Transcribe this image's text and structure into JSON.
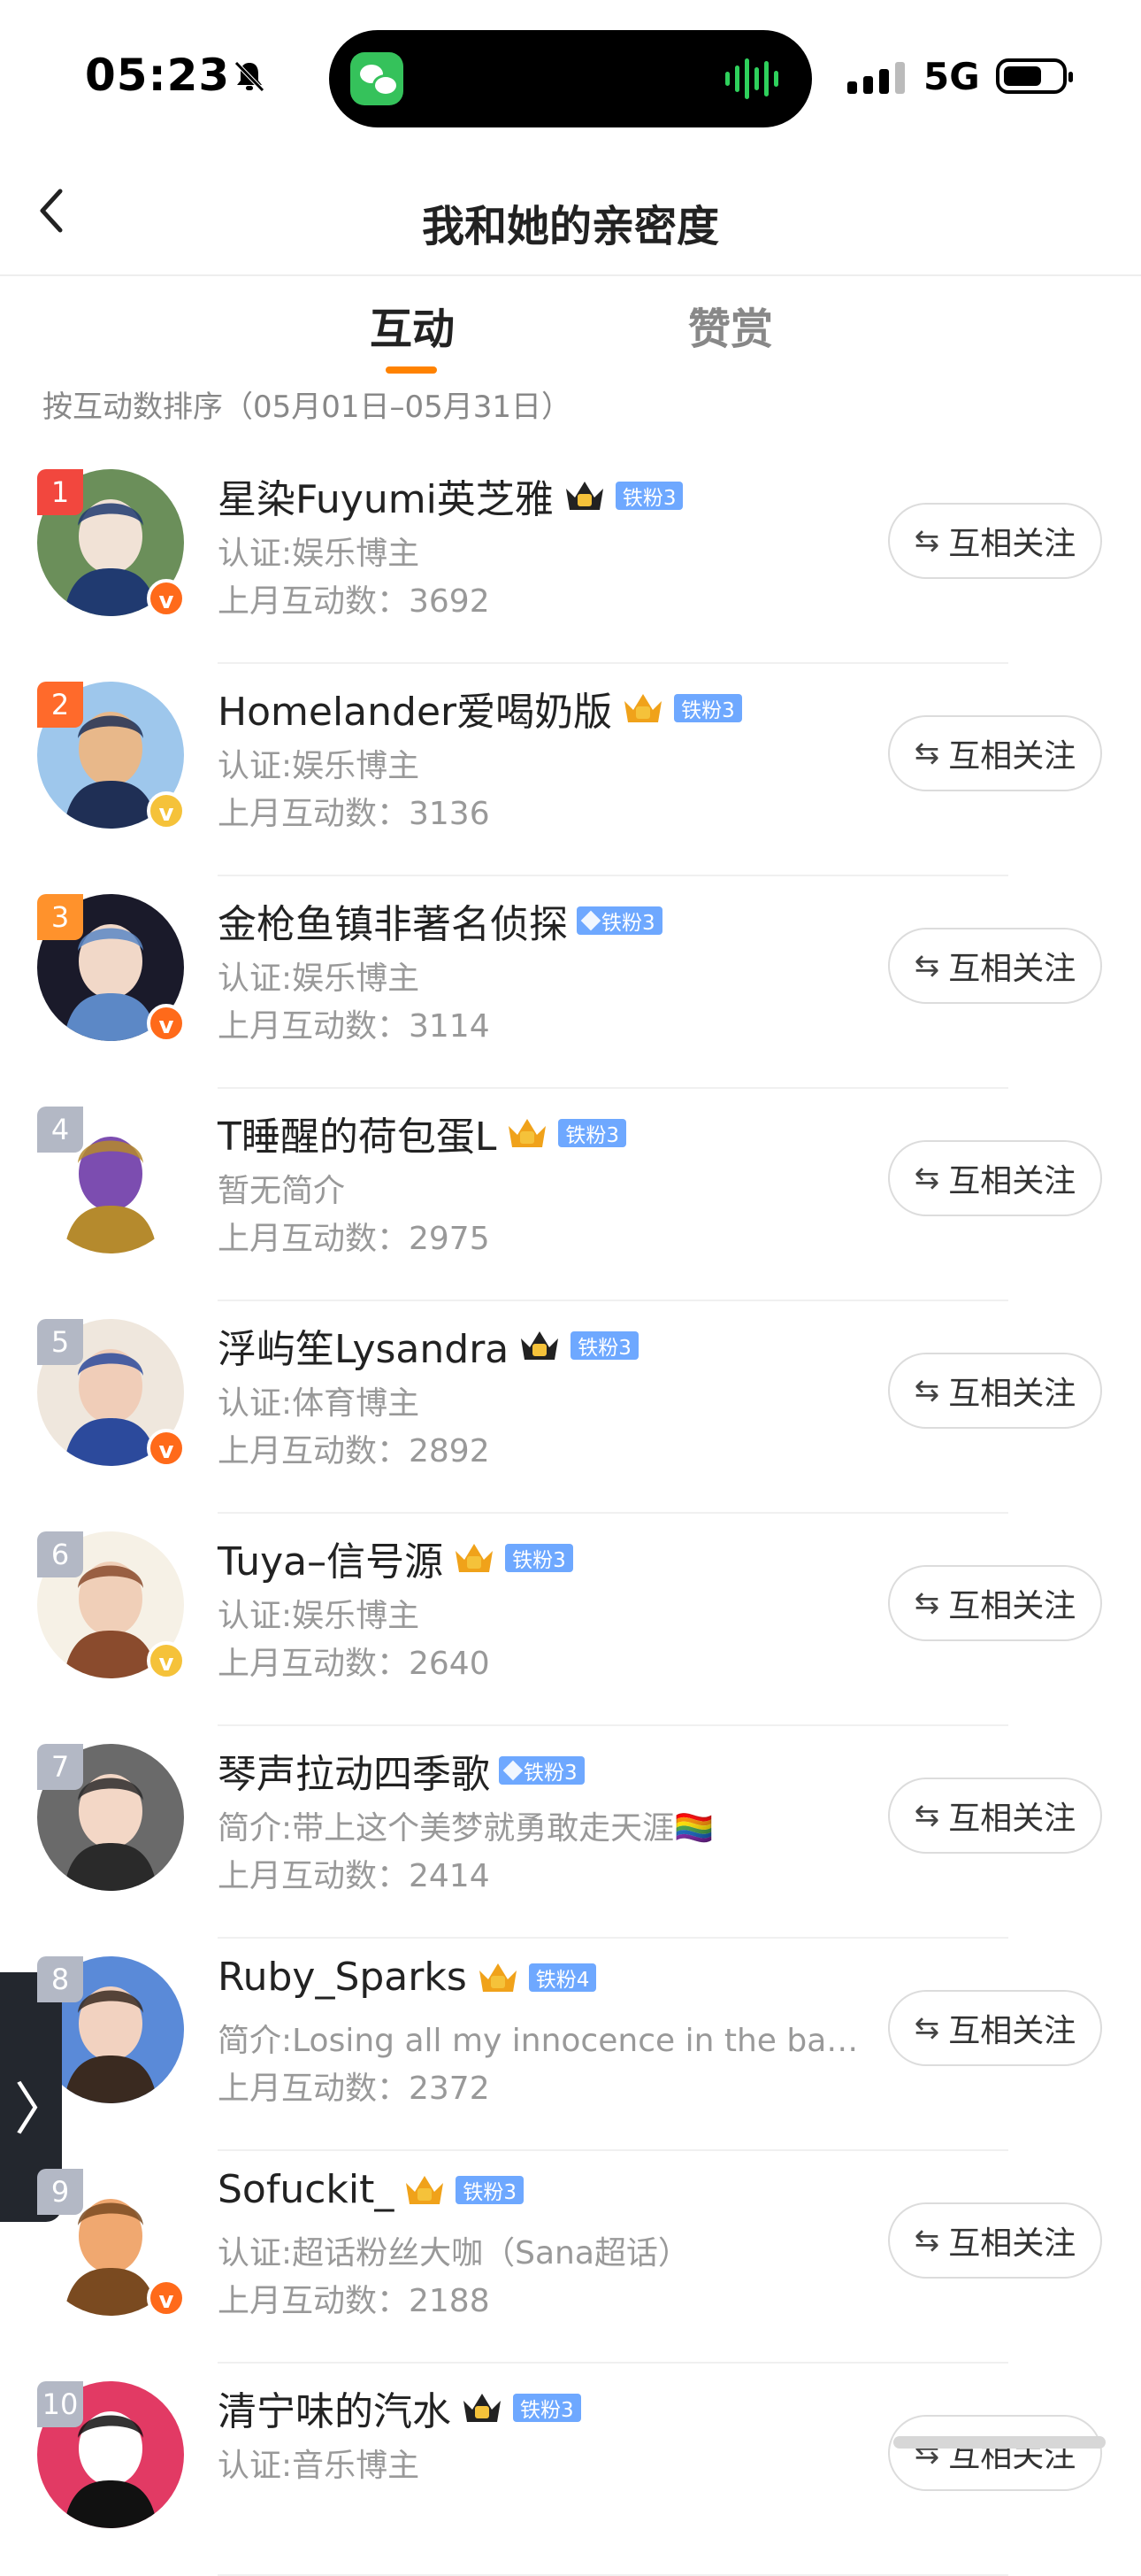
{
  "status_bar": {
    "time": "05:23",
    "network": "5G"
  },
  "nav": {
    "title": "我和她的亲密度"
  },
  "tabs": [
    {
      "label": "互动"
    },
    {
      "label": "赞赏"
    }
  ],
  "sort_text": "按互动数排序（05月01日–05月31日）",
  "follow_label": "互相关注",
  "follow_icon": "⇆",
  "colors": {
    "accent": "#ff8200",
    "rank_top": [
      "#f2473e",
      "#ff6a2b",
      "#ff922c"
    ],
    "rank_other": "#b3b8c5",
    "fan_badge": "#6ea8ff",
    "verify_orange": "#ff6a1a",
    "verify_yellow": "#f5c23a"
  },
  "users": [
    {
      "rank": "1",
      "name": "星染Fuyumi英芝雅",
      "fan": "铁粉3",
      "desc": "认证:娱乐博主",
      "count": "上月互动数：3692",
      "verify": "orange",
      "badge": "crown"
    },
    {
      "rank": "2",
      "name": "Homelander爱喝奶版",
      "fan": "铁粉3",
      "desc": "认证:娱乐博主",
      "count": "上月互动数：3136",
      "verify": "yellow",
      "badge": "crown-gold"
    },
    {
      "rank": "3",
      "name": "金枪鱼镇非著名侦探",
      "fan": "铁粉3",
      "desc": "认证:娱乐博主",
      "count": "上月互动数：3114",
      "verify": "orange",
      "badge": "diamond"
    },
    {
      "rank": "4",
      "name": "T睡醒的荷包蛋L",
      "fan": "铁粉3",
      "desc": "暂无简介",
      "count": "上月互动数：2975",
      "verify": "",
      "badge": "crown-gold"
    },
    {
      "rank": "5",
      "name": "浮屿笙Lysandra",
      "fan": "铁粉3",
      "desc": "认证:体育博主",
      "count": "上月互动数：2892",
      "verify": "orange",
      "badge": "crown"
    },
    {
      "rank": "6",
      "name": "Tuya–信号源",
      "fan": "铁粉3",
      "desc": "认证:娱乐博主",
      "count": "上月互动数：2640",
      "verify": "yellow",
      "badge": "crown-gold"
    },
    {
      "rank": "7",
      "name": "琴声拉动四季歌",
      "fan": "铁粉3",
      "desc": "简介:带上这个美梦就勇敢走天涯🏳️‍🌈",
      "count": "上月互动数：2414",
      "verify": "",
      "badge": "diamond"
    },
    {
      "rank": "8",
      "name": "Ruby_Sparks",
      "fan": "铁粉4",
      "desc": "简介:Losing all my innocence in the back…",
      "count": "上月互动数：2372",
      "verify": "",
      "badge": "crown-gold"
    },
    {
      "rank": "9",
      "name": "Sofuckit_",
      "fan": "铁粉3",
      "desc": "认证:超话粉丝大咖（Sana超话）",
      "count": "上月互动数：2188",
      "verify": "orange",
      "badge": "crown-gold"
    },
    {
      "rank": "10",
      "name": "清宁味的汽水",
      "fan": "铁粉3",
      "desc": "认证:音乐博主",
      "count": "",
      "verify": "",
      "badge": "crown"
    }
  ]
}
